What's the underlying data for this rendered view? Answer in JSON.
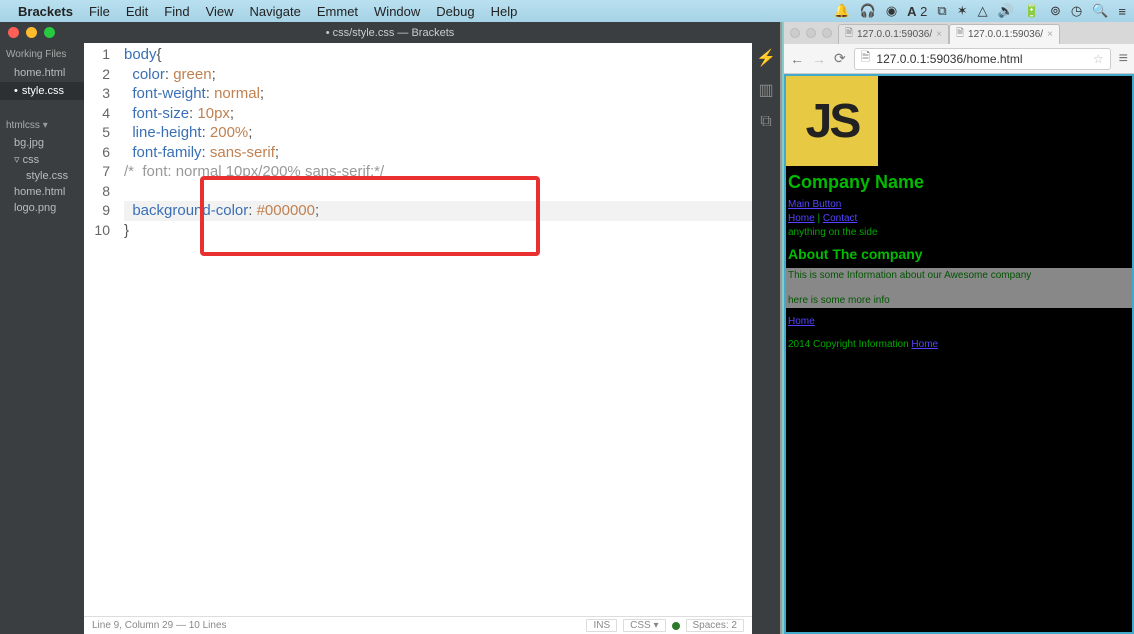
{
  "menubar": {
    "app": "Brackets",
    "items": [
      "File",
      "Edit",
      "Find",
      "View",
      "Navigate",
      "Emmet",
      "Window",
      "Debug",
      "Help"
    ]
  },
  "editor": {
    "title": "• css/style.css — Brackets",
    "workingFilesHead": "Working Files",
    "workingFiles": [
      {
        "name": "home.html",
        "active": false,
        "dirty": false
      },
      {
        "name": "style.css",
        "active": true,
        "dirty": true
      }
    ],
    "projectHead": "htmlcss",
    "tree": [
      {
        "label": "bg.jpg",
        "indent": false
      },
      {
        "label": "css",
        "indent": false,
        "folder": true
      },
      {
        "label": "style.css",
        "indent": true
      },
      {
        "label": "home.html",
        "indent": false
      },
      {
        "label": "logo.png",
        "indent": false
      }
    ],
    "code": [
      {
        "n": "1",
        "sel": "body",
        "punc": "{"
      },
      {
        "n": "2",
        "prop": "color",
        "val": "green"
      },
      {
        "n": "3",
        "prop": "font-weight",
        "val": "normal"
      },
      {
        "n": "4",
        "prop": "font-size",
        "val": "10px"
      },
      {
        "n": "5",
        "prop": "line-height",
        "val": "200%"
      },
      {
        "n": "6",
        "prop": "font-family",
        "val": "sans-serif"
      },
      {
        "n": "7",
        "comment": "/*  font: normal 10px/200% sans-serif;*/"
      },
      {
        "n": "8",
        "blank": true
      },
      {
        "n": "9",
        "prop": "background-color",
        "val": "#000000"
      },
      {
        "n": "10",
        "close": "}"
      }
    ],
    "status": {
      "left": "Line 9, Column 29 — 10 Lines",
      "ins": "INS",
      "lang": "CSS",
      "spaces": "Spaces: 2"
    }
  },
  "browser": {
    "tab1": "127.0.0.1:59036/",
    "tab2": "127.0.0.1:59036/",
    "url": "127.0.0.1:59036/home.html",
    "logo": "JS",
    "h1": "Company Name",
    "mainBtn": "Main Button",
    "navHome": "Home",
    "navSep": " | ",
    "navContact": "Contact",
    "aside": "anything on the side",
    "h2": "About The company",
    "p1": "This is some Information about our Awesome company",
    "p2": "here is some more info",
    "link2": "Home",
    "footer": "2014 Copyright Information ",
    "footerLink": "Home"
  }
}
